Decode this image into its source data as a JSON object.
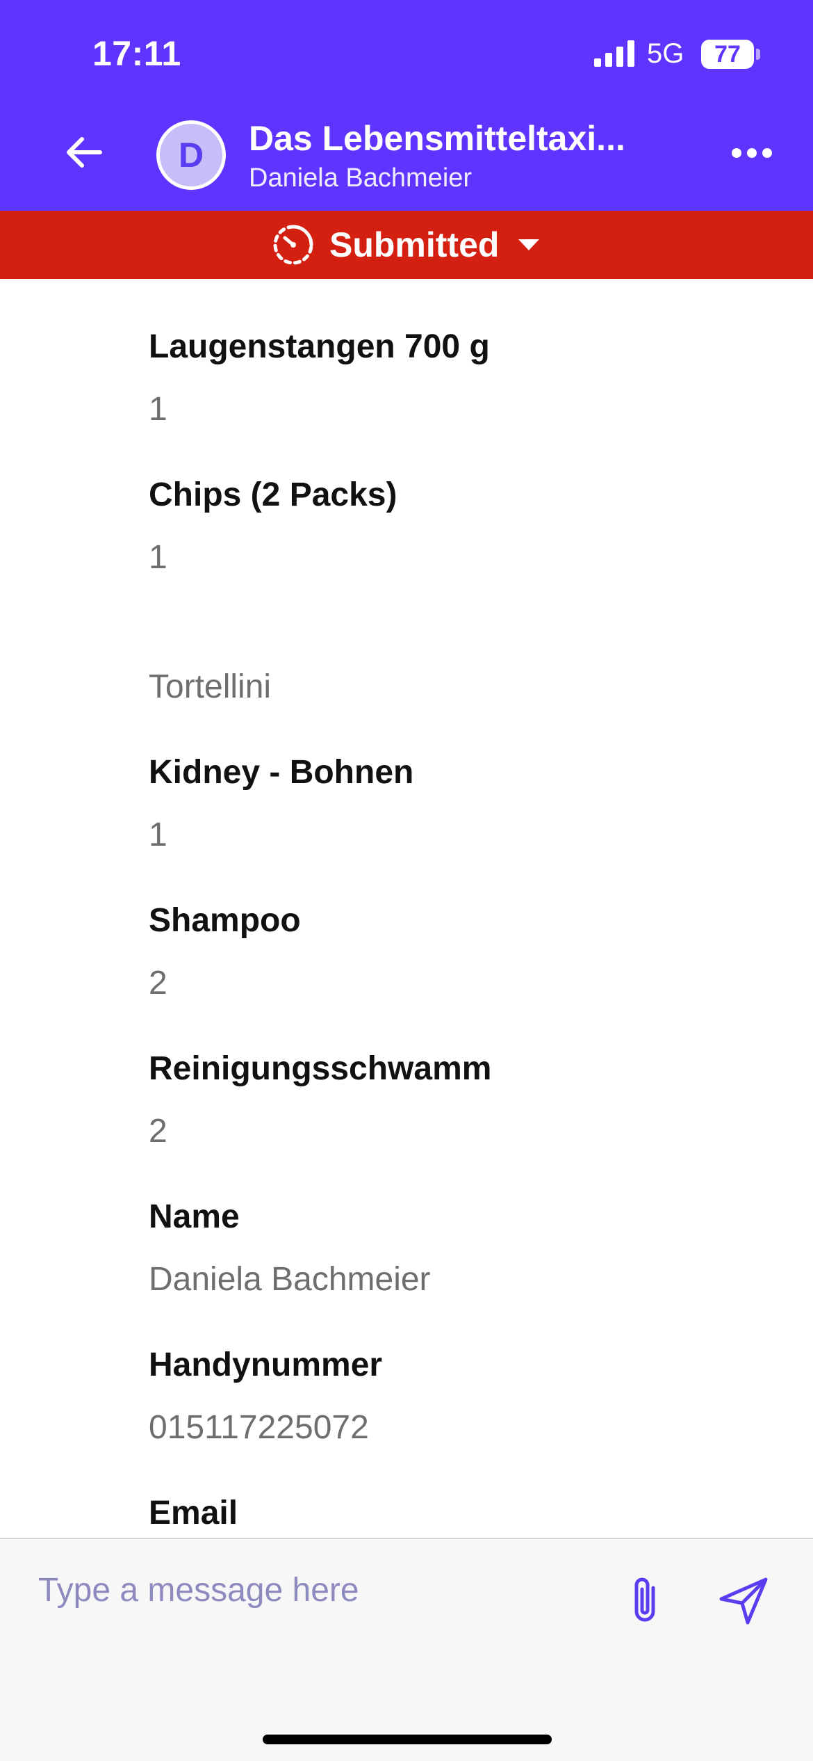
{
  "status_bar": {
    "time": "17:11",
    "network": "5G",
    "battery_percent": 77,
    "battery_text": "77"
  },
  "header": {
    "avatar_initial": "D",
    "title": "Das Lebensmitteltaxi...",
    "subtitle": "Daniela Bachmeier"
  },
  "order_status": {
    "label": "Submitted",
    "color": "#d42010"
  },
  "fields": [
    {
      "label": "Laugenstangen 700 g",
      "value": "1"
    },
    {
      "label": "Chips (2 Packs)",
      "value": "1"
    },
    {
      "label": "",
      "value": "Tortellini"
    },
    {
      "label": "Kidney - Bohnen",
      "value": "1"
    },
    {
      "label": "Shampoo",
      "value": "2"
    },
    {
      "label": "Reinigungsschwamm",
      "value": "2"
    },
    {
      "label": "Name",
      "value": "Daniela Bachmeier"
    },
    {
      "label": "Handynummer",
      "value": "015117225072"
    },
    {
      "label": "Email",
      "value": ""
    }
  ],
  "composer": {
    "placeholder": "Type a message here"
  },
  "colors": {
    "brand": "#6034ff",
    "status": "#d42010",
    "composer_icons": "#5b3cf0"
  }
}
